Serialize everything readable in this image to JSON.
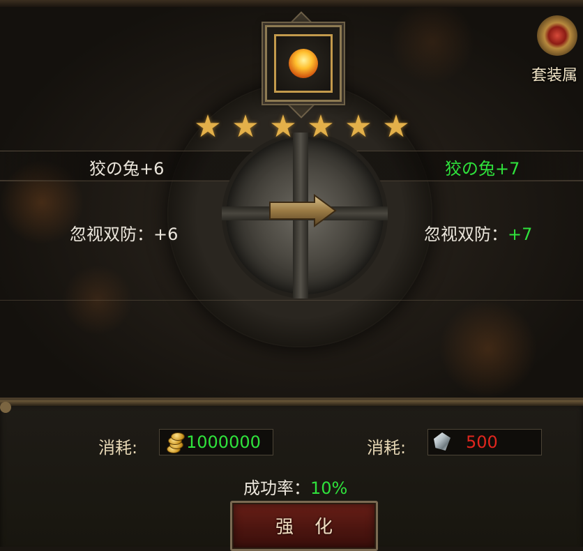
{
  "set_badge": {
    "label": "套装属"
  },
  "stars": {
    "count": 6,
    "symbol": "★"
  },
  "upgrade": {
    "current": {
      "name": "狡の兔+6",
      "stat_label": "忽视双防：",
      "stat_value": "+6"
    },
    "next": {
      "name": "狡の兔+7",
      "stat_label": "忽视双防：",
      "stat_value": "+7"
    }
  },
  "costs": [
    {
      "label": "消耗:",
      "icon": "gold-coins-icon",
      "value": "1000000",
      "value_color": "#2fe23c"
    },
    {
      "label": "消耗:",
      "icon": "crystal-shard-icon",
      "value": "500",
      "value_color": "#e0261e"
    }
  ],
  "success_rate": {
    "label": "成功率：",
    "value": "10%"
  },
  "enhance_button": {
    "label": "强化"
  },
  "colors": {
    "green": "#2fe23c",
    "red": "#e0261e",
    "gold": "#e3b04a"
  }
}
